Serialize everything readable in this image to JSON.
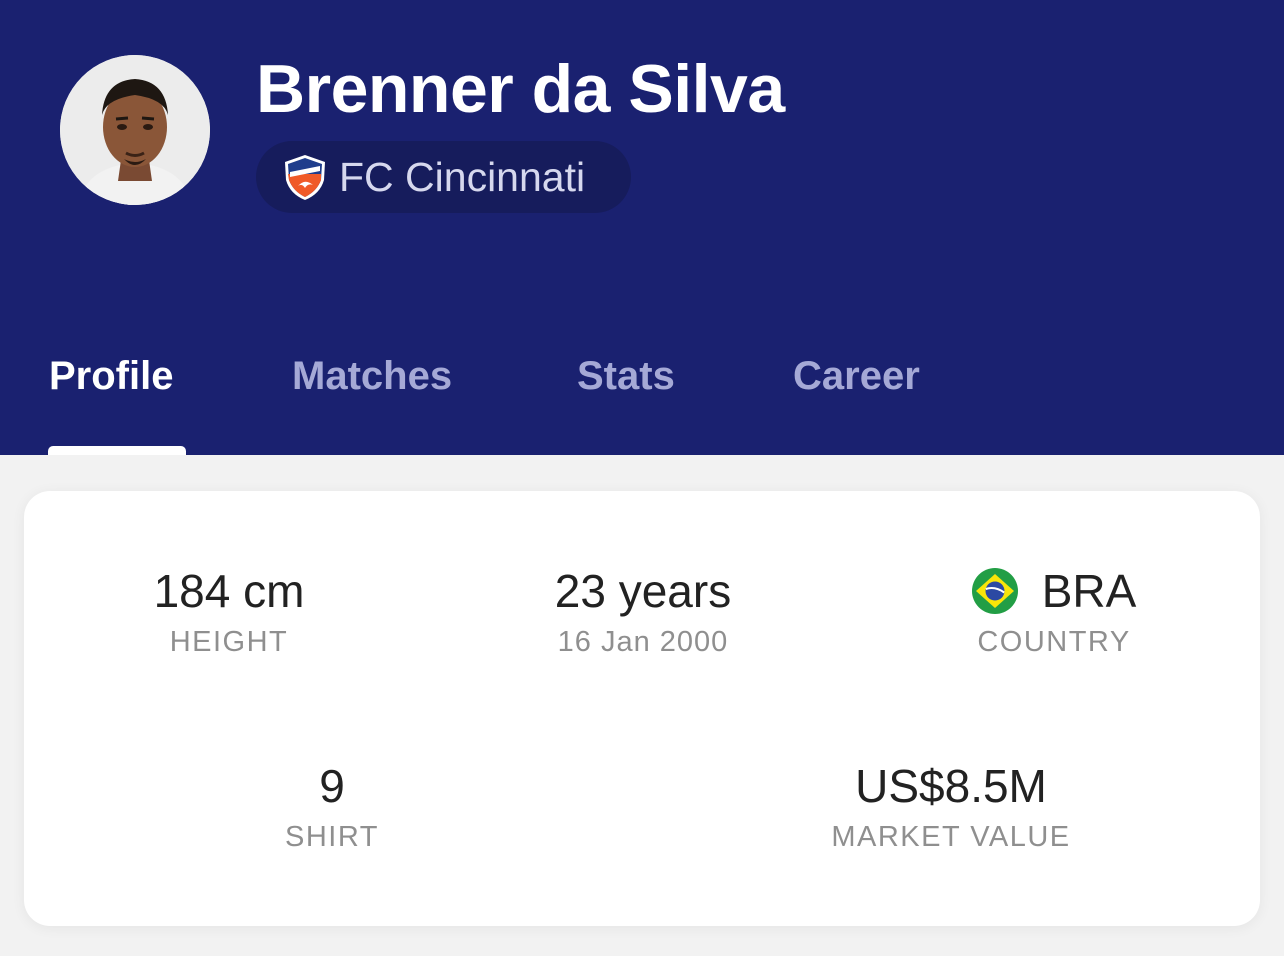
{
  "player": {
    "name": "Brenner da Silva",
    "team": "FC Cincinnati"
  },
  "tabs": [
    {
      "label": "Profile",
      "active": true
    },
    {
      "label": "Matches",
      "active": false
    },
    {
      "label": "Stats",
      "active": false
    },
    {
      "label": "Career",
      "active": false
    }
  ],
  "stats": {
    "height": {
      "value": "184 cm",
      "label": "HEIGHT"
    },
    "age": {
      "value": "23 years",
      "label": "16 Jan 2000"
    },
    "country": {
      "value": "BRA",
      "label": "COUNTRY"
    },
    "shirt": {
      "value": "9",
      "label": "SHIRT"
    },
    "market_value": {
      "value": "US$8.5M",
      "label": "MARKET VALUE"
    }
  },
  "icons": {
    "avatar": "player-avatar-photo",
    "team_crest": "fc-cincinnati-crest-icon",
    "country_flag": "brazil-flag-icon"
  },
  "colors": {
    "header_bg": "#1a2170",
    "team_chip_bg": "#161c5c",
    "tab_active": "#ffffff",
    "tab_inactive": "#a5a9d6",
    "crest_orange": "#f05a28"
  }
}
